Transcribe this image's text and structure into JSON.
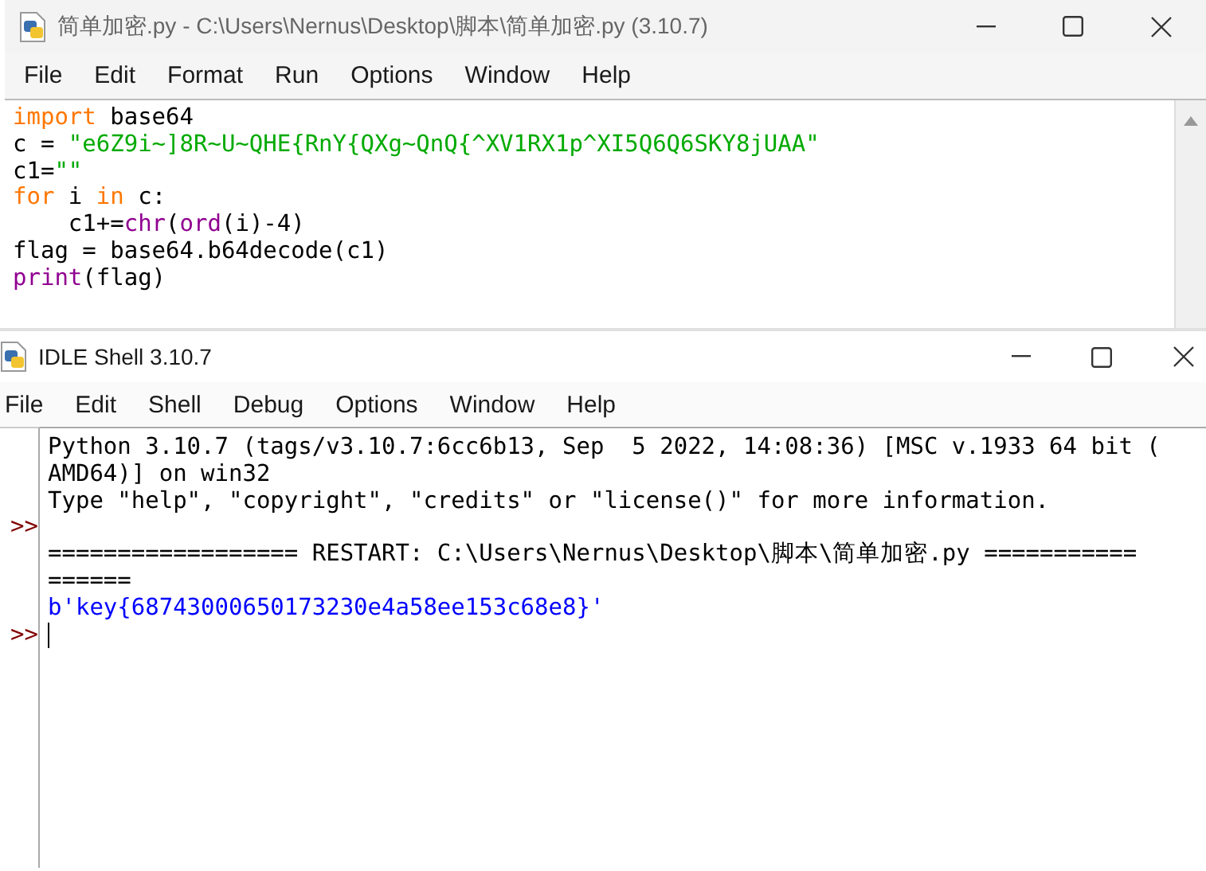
{
  "editor": {
    "title": "简单加密.py - C:\\Users\\Nernus\\Desktop\\脚本\\简单加密.py (3.10.7)",
    "active": false,
    "menu": [
      "File",
      "Edit",
      "Format",
      "Run",
      "Options",
      "Window",
      "Help"
    ],
    "code_lines": [
      {
        "tokens": [
          {
            "kind": "keyword",
            "text": "import"
          },
          {
            "kind": "plain",
            "text": " base64"
          }
        ]
      },
      {
        "tokens": [
          {
            "kind": "plain",
            "text": "c = "
          },
          {
            "kind": "string",
            "text": "\"e6Z9i~]8R~U~QHE{RnY{QXg~QnQ{^XV1RX1p^XI5Q6Q6SKY8jUAA\""
          }
        ]
      },
      {
        "tokens": [
          {
            "kind": "plain",
            "text": "c1="
          },
          {
            "kind": "string",
            "text": "\"\""
          }
        ]
      },
      {
        "tokens": [
          {
            "kind": "keyword",
            "text": "for"
          },
          {
            "kind": "plain",
            "text": " i "
          },
          {
            "kind": "keyword",
            "text": "in"
          },
          {
            "kind": "plain",
            "text": " c:"
          }
        ]
      },
      {
        "tokens": [
          {
            "kind": "plain",
            "text": "    c1+="
          },
          {
            "kind": "builtin",
            "text": "chr"
          },
          {
            "kind": "plain",
            "text": "("
          },
          {
            "kind": "builtin",
            "text": "ord"
          },
          {
            "kind": "plain",
            "text": "(i)-4)"
          }
        ]
      },
      {
        "tokens": [
          {
            "kind": "plain",
            "text": "flag = base64.b64decode(c1)"
          }
        ]
      },
      {
        "tokens": [
          {
            "kind": "builtin",
            "text": "print"
          },
          {
            "kind": "plain",
            "text": "(flag)"
          }
        ]
      }
    ]
  },
  "shell": {
    "title": "IDLE Shell 3.10.7",
    "active": true,
    "menu": [
      "File",
      "Edit",
      "Shell",
      "Debug",
      "Options",
      "Window",
      "Help"
    ],
    "rows": [
      {
        "kind": "output",
        "text": "Python 3.10.7 (tags/v3.10.7:6cc6b13, Sep  5 2022, 14:08:36) [MSC v.1933 64 bit ("
      },
      {
        "kind": "output",
        "text": "AMD64)] on win32"
      },
      {
        "kind": "output",
        "text": "Type \"help\", \"copyright\", \"credits\" or \"license()\" for more information."
      },
      {
        "kind": "prompt",
        "prompt": ">>"
      },
      {
        "kind": "output",
        "text": "================== RESTART: C:\\Users\\Nernus\\Desktop\\脚本\\简单加密.py ==========="
      },
      {
        "kind": "output",
        "text": "======"
      },
      {
        "kind": "result",
        "text": "b'key{68743000650173230e4a58ee153c68e8}'"
      },
      {
        "kind": "input",
        "prompt": ">>"
      }
    ]
  }
}
